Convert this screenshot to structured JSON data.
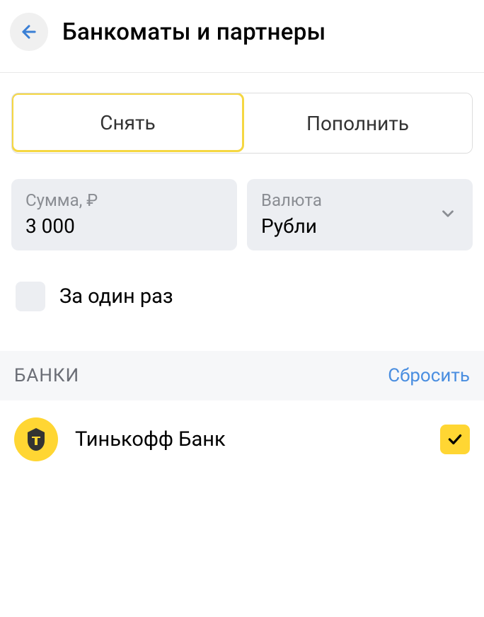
{
  "header": {
    "title": "Банкоматы и партнеры"
  },
  "tabs": {
    "withdraw": "Снять",
    "deposit": "Пополнить"
  },
  "amount": {
    "label": "Сумма, ₽",
    "value": "3 000"
  },
  "currency": {
    "label": "Валюта",
    "value": "Рубли"
  },
  "onetime": {
    "label": "За один раз"
  },
  "banks": {
    "section_title": "БАНКИ",
    "reset_label": "Сбросить",
    "items": [
      {
        "name": "Тинькофф Банк"
      }
    ]
  }
}
